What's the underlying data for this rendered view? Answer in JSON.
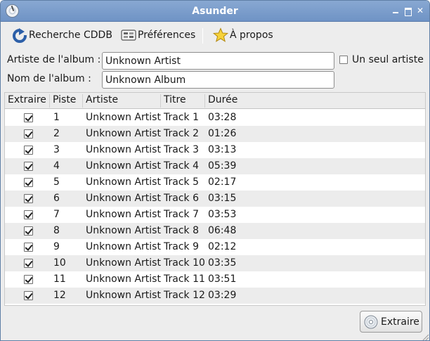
{
  "window": {
    "title": "Asunder",
    "controls": [
      "minimize",
      "maximize",
      "close"
    ]
  },
  "toolbar": {
    "cddb_label": "Recherche CDDB",
    "prefs_label": "Préférences",
    "about_label": "À propos",
    "icons": {
      "cddb": "refresh-icon",
      "prefs": "preferences-icon",
      "about": "star-icon"
    }
  },
  "form": {
    "artist_label": "Artiste de l'album :",
    "artist_value": "Unknown Artist",
    "album_label": "Nom de l'album :",
    "album_value": "Unknown Album",
    "single_artist_label": "Un seul artiste",
    "single_artist_checked": false
  },
  "table": {
    "headers": {
      "extract": "Extraire",
      "track": "Piste",
      "artist": "Artiste",
      "title": "Titre",
      "duration": "Durée"
    },
    "rows": [
      {
        "extract": true,
        "track": "1",
        "artist": "Unknown Artist",
        "title": "Track 1",
        "duration": "03:28"
      },
      {
        "extract": true,
        "track": "2",
        "artist": "Unknown Artist",
        "title": "Track 2",
        "duration": "01:26"
      },
      {
        "extract": true,
        "track": "3",
        "artist": "Unknown Artist",
        "title": "Track 3",
        "duration": "03:13"
      },
      {
        "extract": true,
        "track": "4",
        "artist": "Unknown Artist",
        "title": "Track 4",
        "duration": "05:39"
      },
      {
        "extract": true,
        "track": "5",
        "artist": "Unknown Artist",
        "title": "Track 5",
        "duration": "02:17"
      },
      {
        "extract": true,
        "track": "6",
        "artist": "Unknown Artist",
        "title": "Track 6",
        "duration": "03:15"
      },
      {
        "extract": true,
        "track": "7",
        "artist": "Unknown Artist",
        "title": "Track 7",
        "duration": "03:53"
      },
      {
        "extract": true,
        "track": "8",
        "artist": "Unknown Artist",
        "title": "Track 8",
        "duration": "06:48"
      },
      {
        "extract": true,
        "track": "9",
        "artist": "Unknown Artist",
        "title": "Track 9",
        "duration": "02:12"
      },
      {
        "extract": true,
        "track": "10",
        "artist": "Unknown Artist",
        "title": "Track 10",
        "duration": "03:35"
      },
      {
        "extract": true,
        "track": "11",
        "artist": "Unknown Artist",
        "title": "Track 11",
        "duration": "03:51"
      },
      {
        "extract": true,
        "track": "12",
        "artist": "Unknown Artist",
        "title": "Track 12",
        "duration": "03:29"
      }
    ]
  },
  "footer": {
    "extract_label": "Extraire",
    "extract_icon": "disc-icon"
  },
  "colors": {
    "titlebar": "#7b9ccb",
    "row_alt": "#ececec",
    "window_bg": "#ededed"
  }
}
